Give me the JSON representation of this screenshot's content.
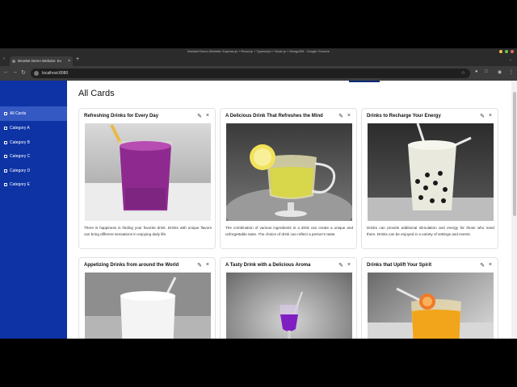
{
  "browser": {
    "window_title": "Bmwlwt Demo Website: Express.js + React.js + Typescript + Node.js + MongoDB - Google Chrome",
    "tab_title": "Bmwlwt Demo Website: Ex",
    "url": "localhost:8080"
  },
  "sidebar": {
    "items": [
      {
        "label": "All Cards"
      },
      {
        "label": "Category A"
      },
      {
        "label": "Category B"
      },
      {
        "label": "Category C"
      },
      {
        "label": "Category D"
      },
      {
        "label": "Category E"
      }
    ]
  },
  "main": {
    "heading": "All Cards",
    "cards": [
      {
        "title": "Refreshing Drinks for Every Day",
        "description": "There is happiness in finding your favorite drink. Drinks with unique flavors can bring different sensations in enjoying daily life."
      },
      {
        "title": "A Delicious Drink That Refreshes the Mind",
        "description": "The combination of various ingredients in a drink can create a unique and unforgettable taste. The choice of drink can reflect a person's taste."
      },
      {
        "title": "Drinks to Recharge Your Energy",
        "description": "Drinks can provide additional stimulation and energy for those who need them. Drinks can be enjoyed in a variety of settings and events."
      },
      {
        "title": "Appetizing Drinks from around the World",
        "description": ""
      },
      {
        "title": "A Tasty Drink with a Delicious Aroma",
        "description": ""
      },
      {
        "title": "Drinks that Uplift Your Spirit",
        "description": ""
      }
    ]
  },
  "colors": {
    "sidebar": "#0d33a5",
    "sidebar_active": "#3459c2",
    "browser_dark": "#2b2b2b"
  }
}
